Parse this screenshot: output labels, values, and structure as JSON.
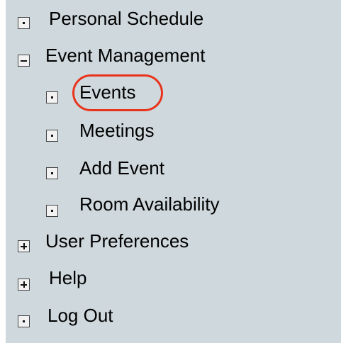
{
  "nav": {
    "items": [
      {
        "id": "personal-schedule",
        "label": "Personal Schedule",
        "icon": "dot-box-icon"
      },
      {
        "id": "event-management",
        "label": "Event Management",
        "icon": "minus-box-icon",
        "expanded": true
      },
      {
        "id": "events",
        "label": "Events",
        "icon": "dot-box-icon",
        "highlighted": true
      },
      {
        "id": "meetings",
        "label": "Meetings",
        "icon": "dot-box-icon"
      },
      {
        "id": "add-event",
        "label": "Add Event",
        "icon": "dot-box-icon"
      },
      {
        "id": "room-availability",
        "label": "Room Availability",
        "icon": "dot-box-icon"
      },
      {
        "id": "user-preferences",
        "label": "User Preferences",
        "icon": "plus-box-icon",
        "expanded": false
      },
      {
        "id": "help",
        "label": "Help",
        "icon": "plus-box-icon",
        "expanded": false
      },
      {
        "id": "log-out",
        "label": "Log Out",
        "icon": "dot-box-icon"
      }
    ]
  },
  "colors": {
    "panel_background": "#cfd8dd",
    "highlight_ring": "#e8341c"
  }
}
